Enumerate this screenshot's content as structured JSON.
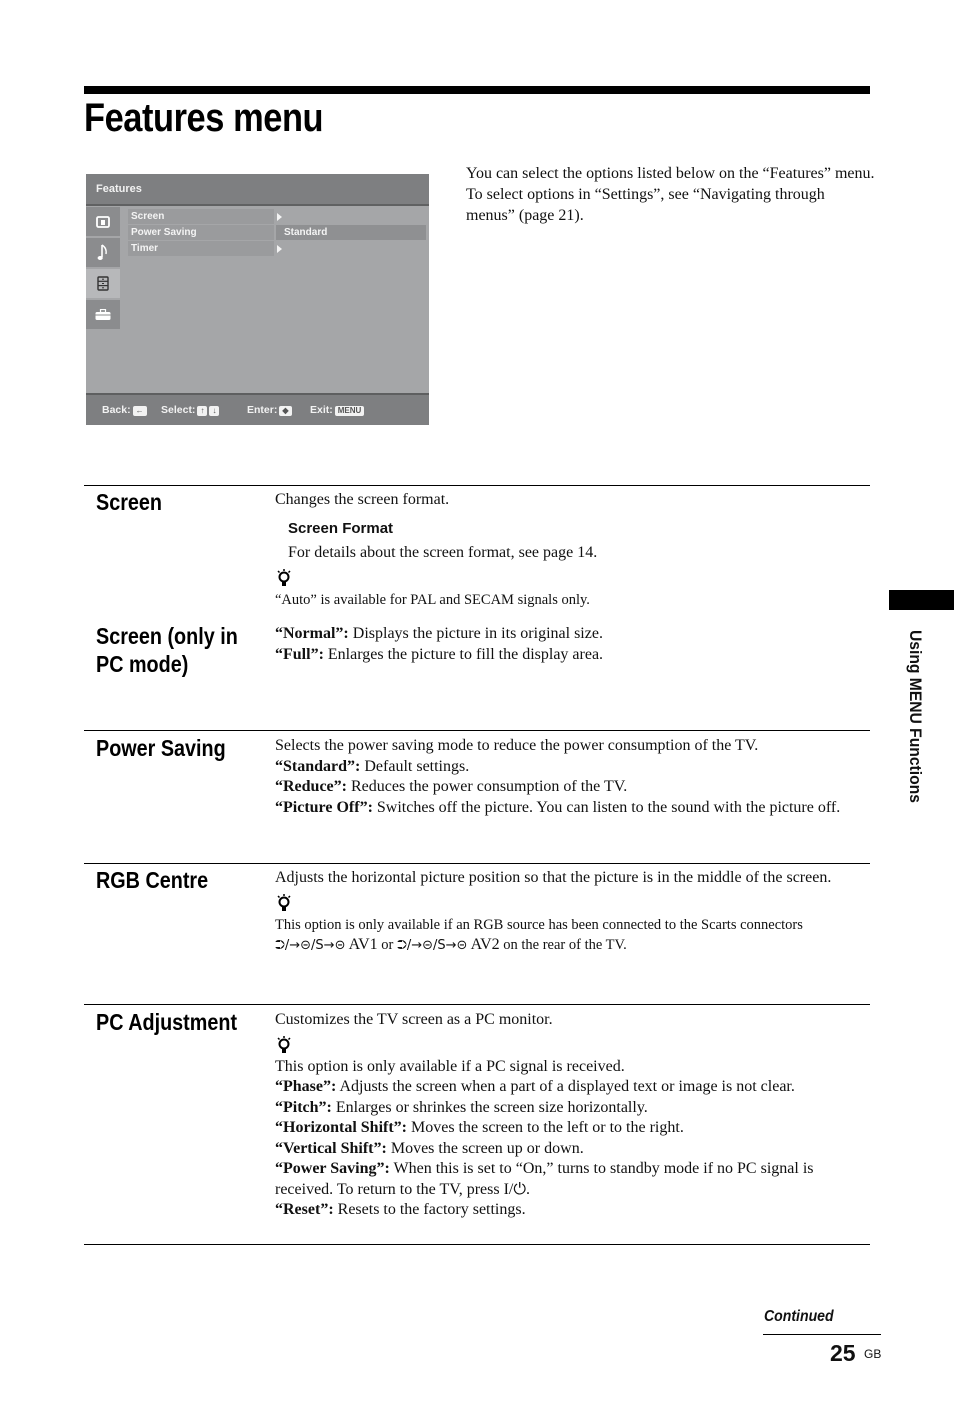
{
  "page": {
    "title": "Features menu",
    "intro": "You can select the options listed below on the “Features” menu. To select options in “Settings”, see “Navigating through menus” (page 21).",
    "side_tab": "Using MENU Functions",
    "continued": "Continued",
    "page_number": "25",
    "page_lang": "GB"
  },
  "tv_menu": {
    "header": "Features",
    "icons": [
      "picture-icon",
      "sound-icon",
      "features-icon",
      "settings-icon"
    ],
    "active_icon_index": 2,
    "rows": [
      {
        "label": "Screen",
        "value": "",
        "has_arrow": true
      },
      {
        "label": "Power Saving",
        "value": "Standard",
        "has_arrow": false
      },
      {
        "label": "Timer",
        "value": "",
        "has_arrow": true
      }
    ],
    "footer": {
      "back_label": "Back:",
      "select_label": "Select:",
      "enter_label": "Enter:",
      "exit_label": "Exit:",
      "back_key": "←",
      "select_up_key": "↑",
      "select_down_key": "↓",
      "enter_key": "◆",
      "exit_key": "MENU"
    }
  },
  "sections": {
    "screen": {
      "title": "Screen",
      "desc": "Changes the screen format.",
      "sub_heading": "Screen Format",
      "sub_text": "For details about the screen format, see page 14.",
      "hint": "“Auto” is available for PAL and SECAM signals only."
    },
    "screen_pc": {
      "title": "Screen (only in PC mode)",
      "items": [
        {
          "term": "“Normal”:",
          "text": " Displays the picture in its original size."
        },
        {
          "term": "“Full”:",
          "text": " Enlarges the picture to fill the display area."
        }
      ]
    },
    "power_saving": {
      "title": "Power Saving",
      "desc": "Selects the power saving mode to reduce the power consumption of the TV.",
      "items": [
        {
          "term": "“Standard”:",
          "text": " Default settings."
        },
        {
          "term": "“Reduce”:",
          "text": " Reduces the power consumption of the TV."
        },
        {
          "term": "“Picture Off”:",
          "text": " Switches off the picture. You can listen to the sound with the picture off."
        }
      ]
    },
    "rgb_centre": {
      "title": "RGB Centre",
      "desc": "Adjusts the horizontal picture position so that the picture is in the middle of the screen.",
      "hint_a": "This option is only available if an RGB source has been connected to the Scarts connectors",
      "scart_symbol": "⮊/→⊝/S→⊝",
      "av1": " AV1",
      "or": " or ",
      "av2": " AV2",
      "hint_end": " on the rear of the TV."
    },
    "pc_adjustment": {
      "title": "PC Adjustment",
      "desc": "Customizes the TV screen as a PC monitor.",
      "hint": "This option is only available if a PC signal is received.",
      "items": [
        {
          "term": "“Phase”:",
          "text": " Adjusts the screen when a part of a displayed text or image is not clear."
        },
        {
          "term": "“Pitch”:",
          "text": " Enlarges or shrinkes the screen size horizontally."
        },
        {
          "term": "“Horizontal Shift”:",
          "text": " Moves the screen to the left or to the right."
        },
        {
          "term": "“Vertical Shift”:",
          "text": " Moves the screen up or down."
        },
        {
          "term": "“Power Saving”:",
          "text": " When this is set to “On,” turns to standby mode if no PC signal is received. To return to the TV, press I/⏻."
        },
        {
          "term": "“Reset”:",
          "text": " Resets to the factory settings."
        }
      ]
    }
  }
}
